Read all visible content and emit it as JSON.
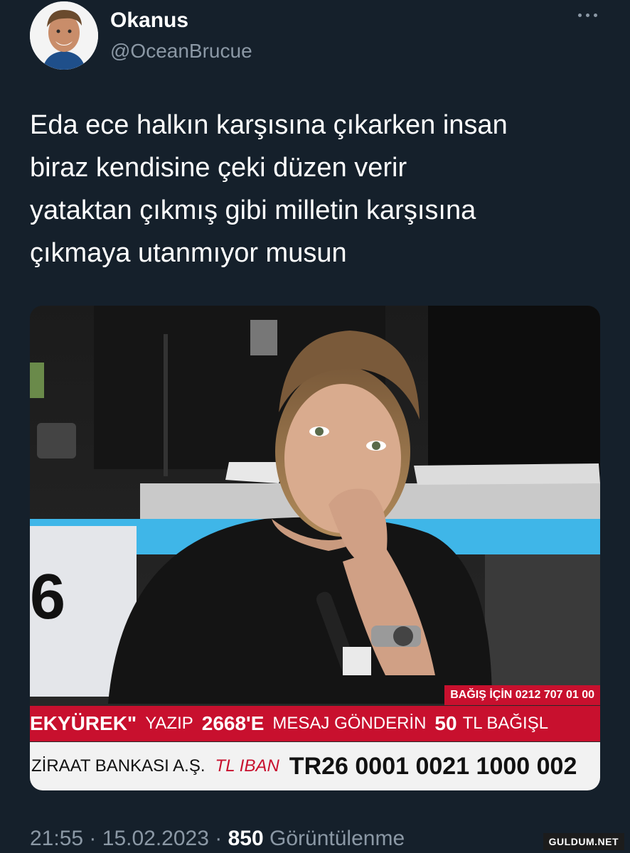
{
  "tweet": {
    "author_name": "Okanus",
    "author_handle": "@OceanBrucue",
    "text": "Eda ece halkın karşısına çıkarken insan\nbiraz kendisine çeki düzen verir\nyataktan çıkmış gibi milletin karşısına\nçıkmaya utanmıyor musun",
    "time": "21:55",
    "separator": "·",
    "date": "15.02.2023",
    "views_count": "850",
    "views_label": "Görüntülenme"
  },
  "media": {
    "studio_number": "6",
    "donate_phone": "BAĞIŞ İÇİN 0212 707 01 00",
    "sms_part1": "EKYÜREK\"",
    "sms_part2": "YAZIP",
    "sms_part3": "2668'E",
    "sms_part4": "MESAJ GÖNDERİN",
    "sms_part5": "50",
    "sms_part6": "TL BAĞIŞL",
    "bank": "ZİRAAT BANKASI A.Ş.",
    "iban_label": "TL IBAN",
    "iban": "TR26 0001 0021 1000 002"
  },
  "icons": {
    "more": "more-horizontal-icon"
  },
  "watermark": "GULDUM.NET",
  "colors": {
    "background": "#15202b",
    "secondary_text": "#8b98a5",
    "banner_red": "#c8102e"
  }
}
